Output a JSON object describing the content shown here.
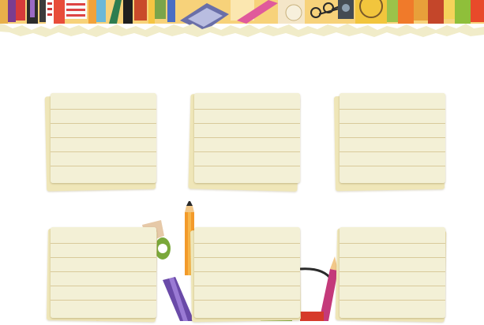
{
  "notes": [
    {
      "id": "note-1",
      "lines": 6
    },
    {
      "id": "note-2",
      "lines": 6
    },
    {
      "id": "note-3",
      "lines": 6
    },
    {
      "id": "note-4",
      "lines": 6
    },
    {
      "id": "note-5",
      "lines": 6
    },
    {
      "id": "note-6",
      "lines": 6
    }
  ],
  "colors": {
    "paper": "#f3f0d6",
    "paper_shadow": "#efe6b8",
    "rule_line": "#d9ca9a",
    "torn_edge": "#f1ecc9"
  },
  "icons": [
    "pencil-icon",
    "marker-icon",
    "scissors-icon",
    "brush-icon",
    "calculator-icon"
  ]
}
